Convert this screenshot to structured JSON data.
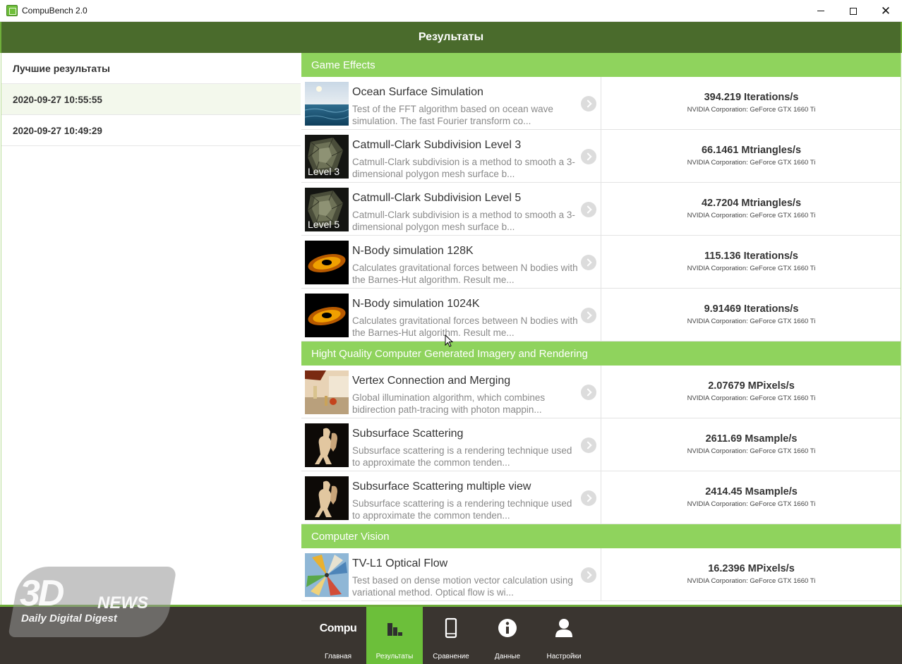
{
  "app": {
    "title": "CompuBench 2.0"
  },
  "window_controls": {
    "minimize": "–",
    "maximize": "☐",
    "close": "✕"
  },
  "header": {
    "title": "Результаты"
  },
  "sidebar": {
    "heading": "Лучшие результаты",
    "items": [
      {
        "label": "2020-09-27 10:55:55",
        "selected": true
      },
      {
        "label": "2020-09-27 10:49:29",
        "selected": false
      }
    ]
  },
  "sections": [
    {
      "title": "Game Effects",
      "tests": [
        {
          "name": "Ocean Surface Simulation",
          "desc": "Test of the FFT algorithm based on ocean wave simulation. The fast Fourier transform co...",
          "score": "394.219 Iterations/s",
          "device": "NVIDIA Corporation: GeForce GTX 1660 Ti",
          "thumb": "ocean",
          "thumb_label": ""
        },
        {
          "name": "Catmull-Clark Subdivision Level 3",
          "desc": "Catmull-Clark subdivision is a method to smooth a 3-dimensional polygon mesh surface b...",
          "score": "66.1461 Mtriangles/s",
          "device": "NVIDIA Corporation: GeForce GTX 1660 Ti",
          "thumb": "mesh",
          "thumb_label": "Level 3"
        },
        {
          "name": "Catmull-Clark Subdivision Level 5",
          "desc": "Catmull-Clark subdivision is a method to smooth a 3-dimensional polygon mesh surface b...",
          "score": "42.7204 Mtriangles/s",
          "device": "NVIDIA Corporation: GeForce GTX 1660 Ti",
          "thumb": "mesh",
          "thumb_label": "Level 5"
        },
        {
          "name": "N-Body simulation 128K",
          "desc": "Calculates gravitational forces between N bodies with the Barnes-Hut algorithm. Result me...",
          "score": "115.136 Iterations/s",
          "device": "NVIDIA Corporation: GeForce GTX 1660 Ti",
          "thumb": "nbody",
          "thumb_label": ""
        },
        {
          "name": "N-Body simulation 1024K",
          "desc": "Calculates gravitational forces between N bodies with the Barnes-Hut algorithm. Result me...",
          "score": "9.91469 Iterations/s",
          "device": "NVIDIA Corporation: GeForce GTX 1660 Ti",
          "thumb": "nbody",
          "thumb_label": ""
        }
      ]
    },
    {
      "title": "Hight Quality Computer Generated Imagery and Rendering",
      "tests": [
        {
          "name": "Vertex Connection and Merging",
          "desc": "Global illumination algorithm, which combines bidirection path-tracing with photon mappin...",
          "score": "2.07679 MPixels/s",
          "device": "NVIDIA Corporation: GeForce GTX 1660 Ti",
          "thumb": "vcm",
          "thumb_label": ""
        },
        {
          "name": "Subsurface Scattering",
          "desc": "Subsurface scattering is a rendering technique used to approximate the common tenden...",
          "score": "2611.69 Msample/s",
          "device": "NVIDIA Corporation: GeForce GTX 1660 Ti",
          "thumb": "statue",
          "thumb_label": ""
        },
        {
          "name": "Subsurface Scattering multiple view",
          "desc": "Subsurface scattering is a rendering technique used to approximate the common tenden...",
          "score": "2414.45 Msample/s",
          "device": "NVIDIA Corporation: GeForce GTX 1660 Ti",
          "thumb": "statue",
          "thumb_label": ""
        }
      ]
    },
    {
      "title": "Computer Vision",
      "tests": [
        {
          "name": "TV-L1 Optical Flow",
          "desc": "Test based on dense motion vector calculation using variational method. Optical flow is wi...",
          "score": "16.2396 MPixels/s",
          "device": "NVIDIA Corporation: GeForce GTX 1660 Ti",
          "thumb": "flow",
          "thumb_label": ""
        }
      ]
    }
  ],
  "bottom_nav": [
    {
      "id": "home",
      "label": "Главная",
      "text": "Compu",
      "icon": "compu-logo",
      "active": false
    },
    {
      "id": "results",
      "label": "Результаты",
      "icon": "bar-chart-icon",
      "active": true
    },
    {
      "id": "compare",
      "label": "Сравнение",
      "icon": "phone-icon",
      "active": false
    },
    {
      "id": "info",
      "label": "Данные",
      "icon": "info-icon",
      "active": false
    },
    {
      "id": "settings",
      "label": "Настройки",
      "icon": "user-icon",
      "active": false
    }
  ],
  "watermark": {
    "logo": "3D",
    "news": "NEWS",
    "tagline": "Daily Digital Digest"
  },
  "colors": {
    "header": "#4a6b2c",
    "section": "#8fd35d",
    "accent": "#6cbf3a",
    "bottom_bar": "#3a3530"
  }
}
